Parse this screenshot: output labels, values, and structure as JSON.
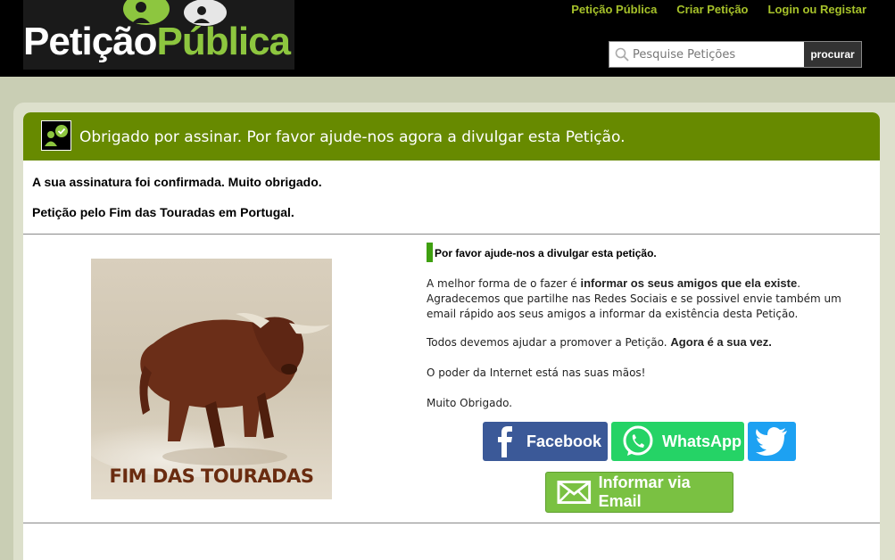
{
  "brand": {
    "logo_part1": "Petição",
    "logo_part2": "Pública"
  },
  "topnav": {
    "items": [
      "Petição Pública",
      "Criar Petição",
      "Login ou Registar"
    ]
  },
  "search": {
    "placeholder": "Pesquise Petições",
    "button_label": "procurar"
  },
  "panel": {
    "header_title": "Obrigado por assinar. Por favor ajude-nos agora a divulgar esta Petição.",
    "confirmation": "A sua assinatura foi confirmada. Muito obrigado.",
    "petition_title": "Petição pelo Fim das Touradas em Portugal."
  },
  "image": {
    "caption": "FIM DAS TOURADAS"
  },
  "help": {
    "title": "Por favor ajude-nos a divulgar esta petição.",
    "p1_a": "A melhor forma de o fazer é ",
    "p1_b": "informar os seus amigos que ela existe",
    "p1_c": ". Agradecemos que partilhe nas Redes Sociais e se possivel envie também um email rápido aos seus amigos a informar da existência desta Petição.",
    "p2_a": "Todos devemos ajudar a promover a Petição. ",
    "p2_b": "Agora é a sua vez.",
    "p3": "O poder da Internet está nas suas mãos!",
    "p4": "Muito Obrigado."
  },
  "share": {
    "facebook": "Facebook",
    "whatsapp": "WhatsApp",
    "email": "Informar via Email"
  },
  "colors": {
    "header_green": "#678a00",
    "nav_link": "#a6c12a",
    "facebook": "#3b5998",
    "whatsapp": "#25d366",
    "twitter": "#1da1f2",
    "email": "#7ac142"
  },
  "icons": [
    "speech-bubbles-icon",
    "search-icon",
    "signed-check-icon",
    "facebook-icon",
    "whatsapp-icon",
    "twitter-icon",
    "email-icon"
  ]
}
